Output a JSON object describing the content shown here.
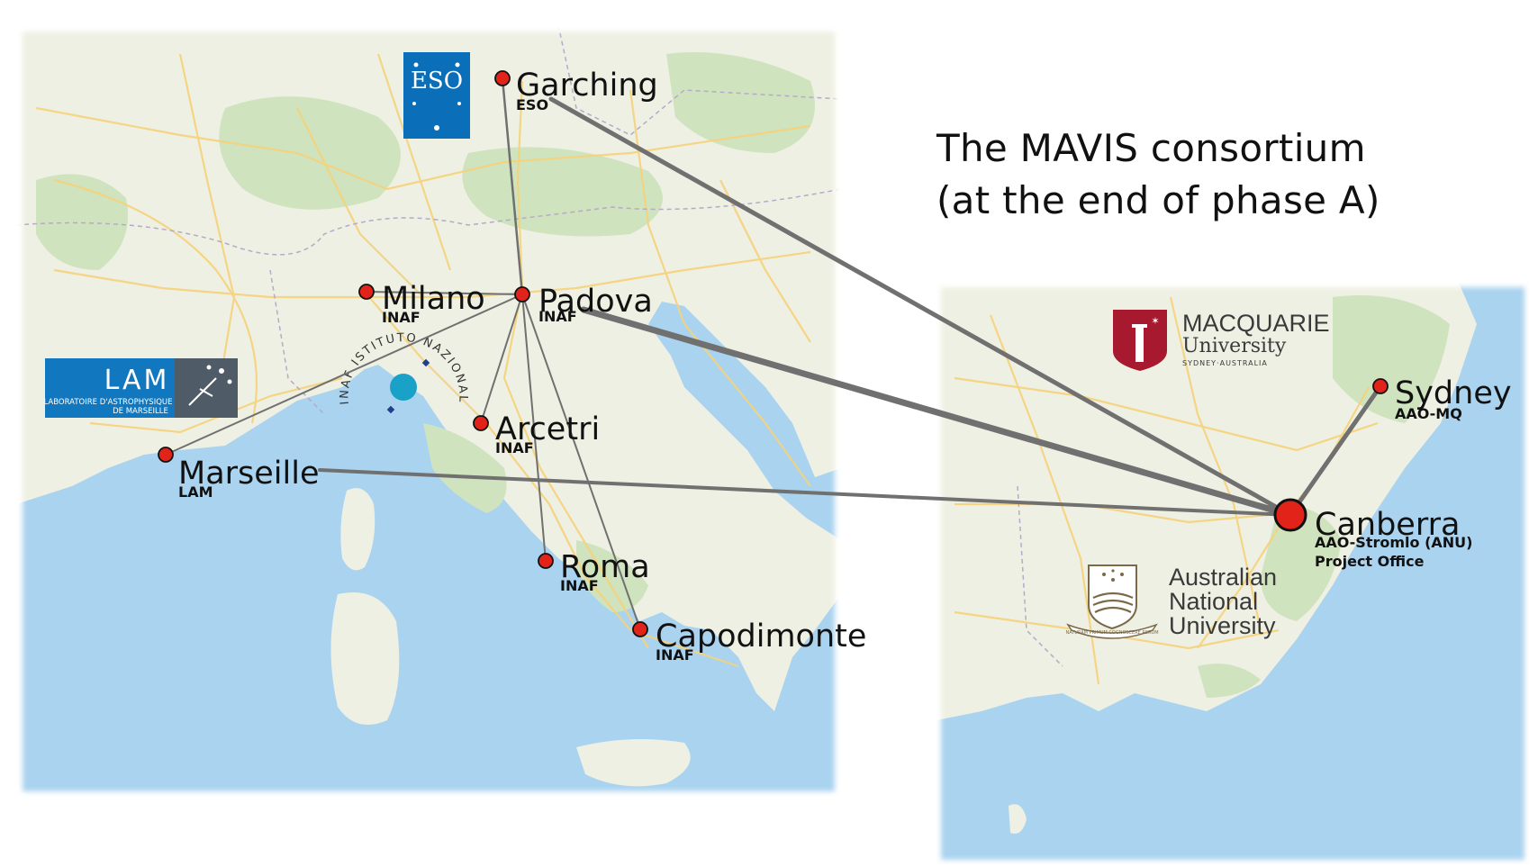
{
  "title": {
    "line1": "The MAVIS consortium",
    "line2": "(at the end of phase A)"
  },
  "colors": {
    "sea": "#aad3ef",
    "land": "#eef0e3",
    "forest": "#cfe3bf",
    "road": "#f6d27a",
    "link_line": "#707070",
    "city_dot": "#e2231a",
    "eso_blue": "#0a6fb8",
    "lam_blue": "#1178bf",
    "macquarie_red": "#a6192e"
  },
  "sites": [
    {
      "id": "garching",
      "name": "Garching",
      "sub": [
        "ESO"
      ]
    },
    {
      "id": "milano",
      "name": "Milano",
      "sub": [
        "INAF"
      ]
    },
    {
      "id": "padova",
      "name": "Padova",
      "sub": [
        "INAF"
      ]
    },
    {
      "id": "arcetri",
      "name": "Arcetri",
      "sub": [
        "INAF"
      ]
    },
    {
      "id": "marseille",
      "name": "Marseille",
      "sub": [
        "LAM"
      ]
    },
    {
      "id": "roma",
      "name": "Roma",
      "sub": [
        "INAF"
      ]
    },
    {
      "id": "capodimonte",
      "name": "Capodimonte",
      "sub": [
        "INAF"
      ]
    },
    {
      "id": "sydney",
      "name": "Sydney",
      "sub": [
        "AAO-MQ"
      ]
    },
    {
      "id": "canberra",
      "name": "Canberra",
      "sub": [
        "AAO-Stromlo (ANU)",
        "Project Office"
      ]
    }
  ],
  "links": [
    {
      "from": "garching",
      "to": "padova"
    },
    {
      "from": "milano",
      "to": "padova"
    },
    {
      "from": "marseille",
      "to": "padova"
    },
    {
      "from": "arcetri",
      "to": "padova"
    },
    {
      "from": "roma",
      "to": "padova"
    },
    {
      "from": "capodimonte",
      "to": "padova"
    },
    {
      "from": "garching",
      "to": "canberra"
    },
    {
      "from": "padova",
      "to": "canberra"
    },
    {
      "from": "marseille",
      "to": "canberra"
    },
    {
      "from": "sydney",
      "to": "canberra"
    }
  ],
  "logos": {
    "eso": {
      "text": "ESO",
      "icon": "eso-logo"
    },
    "lam": {
      "title": "LAM",
      "line1": "LABORATOIRE D'ASTROPHYSIQUE",
      "line2": "DE MARSEILLE",
      "icon": "lam-logo"
    },
    "inaf": {
      "text": "INAF ISTITUTO NAZIONALE DI ASTROFISICA",
      "icon": "inaf-logo"
    },
    "macquarie": {
      "line1": "MACQUARIE",
      "line2": "University",
      "line3": "SYDNEY·AUSTRALIA",
      "icon": "macquarie-crest"
    },
    "anu": {
      "line1": "Australian",
      "line2": "National",
      "line3": "University",
      "motto": "NATURAM PRIMUM COGNOSCERE RERUM",
      "icon": "anu-crest"
    }
  }
}
